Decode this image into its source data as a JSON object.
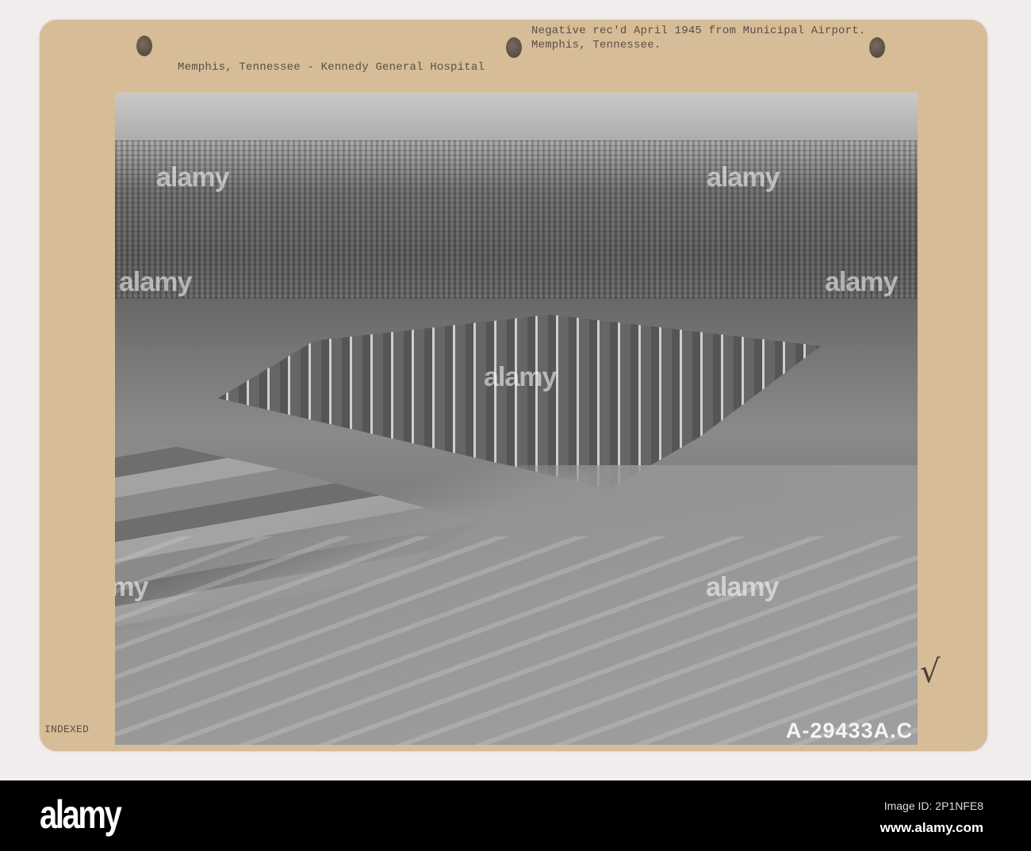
{
  "card": {
    "title": "Memphis, Tennessee - Kennedy General Hospital",
    "note_line1": "Negative rec'd April 1945 from Municipal Airport.",
    "note_line2": "Memphis, Tennessee.",
    "indexed": "INDEXED",
    "check_mark": "√",
    "photo_number": "A-29433A.C"
  },
  "watermarks": [
    "alamy",
    "alamy",
    "alamy",
    "alamy",
    "alamy",
    "alamy",
    "alamy"
  ],
  "footer": {
    "logo": "alamy",
    "image_id": "Image ID: 2P1NFE8",
    "url": "www.alamy.com"
  }
}
